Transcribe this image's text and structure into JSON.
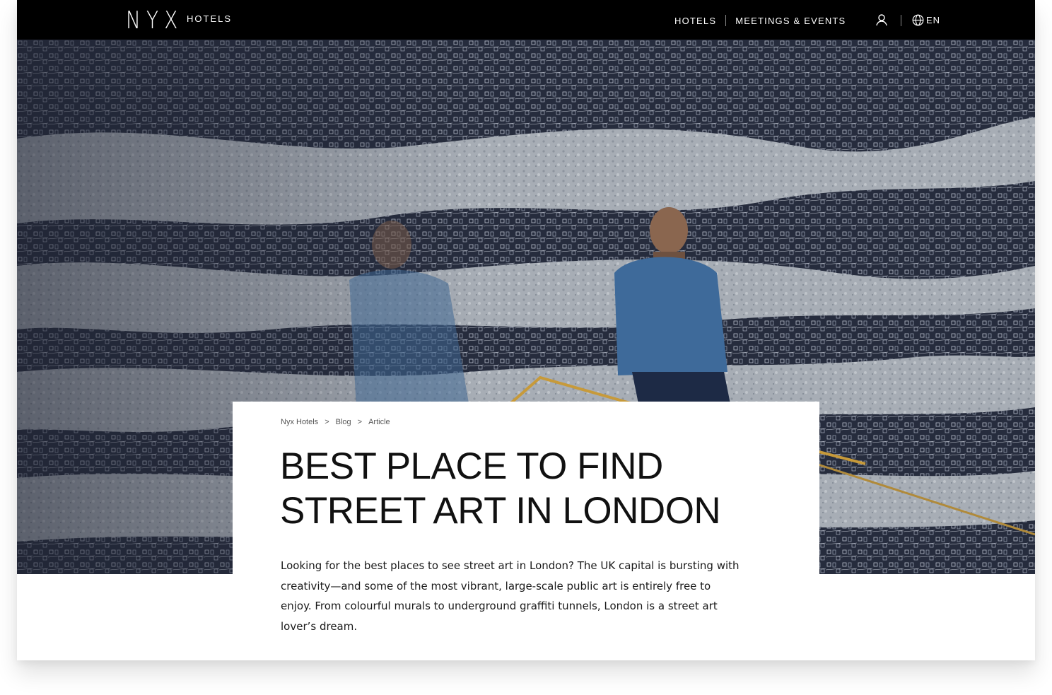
{
  "header": {
    "logo": "NYX",
    "logo_sub": "HOTELS",
    "nav": [
      {
        "label": "HOTELS"
      },
      {
        "label": "MEETINGS & EVENTS"
      }
    ],
    "account_icon": "user-icon",
    "language_icon": "globe-icon",
    "language": "EN"
  },
  "hero": {
    "image": "Man in denim jacket walking down a staircase past a black-and-white city mural, reflected in glass"
  },
  "article": {
    "breadcrumb": [
      "Nyx Hotels",
      "Blog",
      "Article"
    ],
    "breadcrumb_sep": ">",
    "title": "BEST PLACE TO FIND STREET ART IN LONDON",
    "intro": "Looking for the best places to see street art in London? The UK capital is bursting with creativity—and some of the most vibrant, large-scale public art is entirely free to enjoy. From colourful murals to underground graffiti tunnels, London is a street art lover’s dream."
  },
  "colors": {
    "header_bg": "#000000",
    "text": "#111111",
    "card_bg": "#ffffff"
  }
}
